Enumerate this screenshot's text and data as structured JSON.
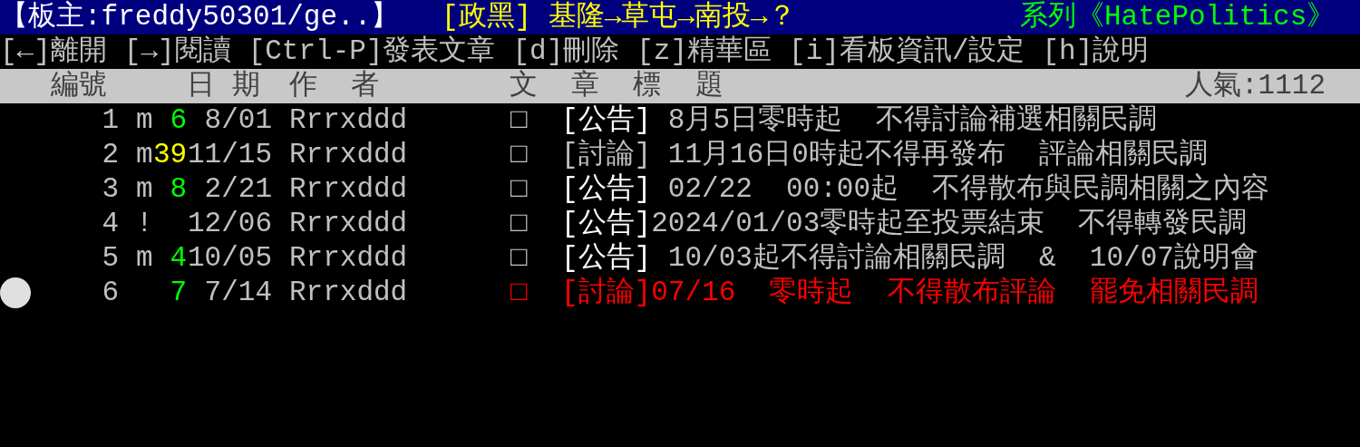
{
  "title_bar": {
    "moderator": "【板主:freddy50301/ge..】",
    "board_title": "[政黑] 基隆→草屯→南投→？",
    "series": "系列《HatePolitics》"
  },
  "menu": [
    {
      "key": "[←]",
      "label": "離開"
    },
    {
      "key": "[→]",
      "label": "閱讀"
    },
    {
      "key": "[Ctrl-P]",
      "label": "發表文章"
    },
    {
      "key": "[d]",
      "label": "刪除"
    },
    {
      "key": "[z]",
      "label": "精華區"
    },
    {
      "key": "[i]",
      "label": "看板資訊/設定"
    },
    {
      "key": "[h]",
      "label": "說明"
    }
  ],
  "columns": {
    "number": "編號",
    "date": "日 期",
    "author": "作  者",
    "title": "文  章  標  題",
    "popularity": "人氣:1112"
  },
  "posts": [
    {
      "number": "1",
      "mark": "m",
      "count": "6",
      "date": "8/01",
      "author": "Rrrxddd",
      "prefix": "□",
      "kind": "announcement",
      "tag": "[公告]",
      "title": " 8月5日零時起  不得討論補選相關民調",
      "color": "#c0c0c0",
      "selected": false
    },
    {
      "number": "2",
      "mark": "m",
      "count": "39",
      "date": "11/15",
      "author": "Rrrxddd",
      "prefix": "□",
      "kind": "discussion",
      "tag": "[討論]",
      "title": " 11月16日0時起不得再發布  評論相關民調",
      "color": "#c0c0c0",
      "selected": false
    },
    {
      "number": "3",
      "mark": "m",
      "count": "8",
      "date": "2/21",
      "author": "Rrrxddd",
      "prefix": "□",
      "kind": "announcement",
      "tag": "[公告]",
      "title": " 02/22  00:00起  不得散布與民調相關之內容",
      "color": "#c0c0c0",
      "selected": false
    },
    {
      "number": "4",
      "mark": "!",
      "date": "12/06",
      "author": "Rrrxddd",
      "prefix": "□",
      "kind": "announcement",
      "tag": "[公告]",
      "title": "2024/01/03零時起至投票結束  不得轉發民調",
      "color": "#c0c0c0",
      "selected": false
    },
    {
      "number": "5",
      "mark": "m",
      "count": "4",
      "date": "10/05",
      "author": "Rrrxddd",
      "prefix": "□",
      "kind": "announcement",
      "tag": "[公告]",
      "title": " 10/03起不得討論相關民調  &  10/07說明會",
      "color": "#c0c0c0",
      "selected": false
    },
    {
      "number": "6",
      "count": "7",
      "date": "7/14",
      "author": "Rrrxddd",
      "prefix": "□",
      "kind": "discussion",
      "tag": "[討論]",
      "title": "07/16  零時起  不得散布評論  罷免相關民調",
      "color": "#ff0000",
      "selected": true
    }
  ]
}
